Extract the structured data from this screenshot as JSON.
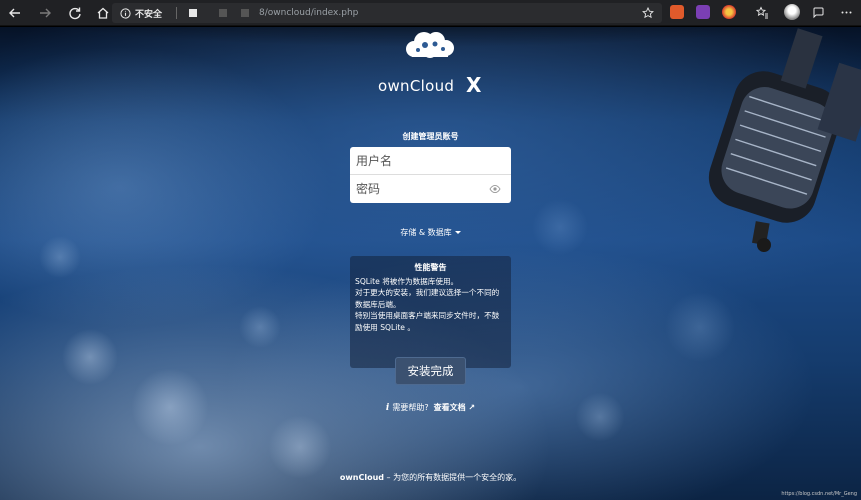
{
  "browser": {
    "security_label": "不安全",
    "url": "8/owncloud/index.php",
    "icons": {
      "back": "arrow-left-icon",
      "forward": "arrow-right-icon",
      "refresh": "refresh-icon",
      "home": "home-icon",
      "info": "info-icon",
      "star": "star-icon",
      "favorites": "favorites-icon",
      "profile": "avatar",
      "feedback": "feedback-icon"
    }
  },
  "logo": {
    "brand": "ownCloud",
    "mark": "X"
  },
  "form": {
    "legend": "创建管理员账号",
    "username_placeholder": "用户名",
    "password_placeholder": "密码",
    "storage_toggle": "存储 & 数据库",
    "warning_title": "性能警告",
    "warning_lines": [
      "SQLite 将被作为数据库使用。",
      "对于更大的安装，我们建议选择一个不同的数据库后端。",
      "特别当使用桌面客户端来同步文件时，不鼓励使用 SQLite 。"
    ],
    "finish_button": "安装完成",
    "help_text": "需要帮助?",
    "docs_link": "查看文档 ↗"
  },
  "footer": {
    "brand": "ownCloud",
    "tagline": " – 为您的所有数据提供一个安全的家。"
  },
  "watermark": "https://blog.csdn.net/Mr_Geng"
}
